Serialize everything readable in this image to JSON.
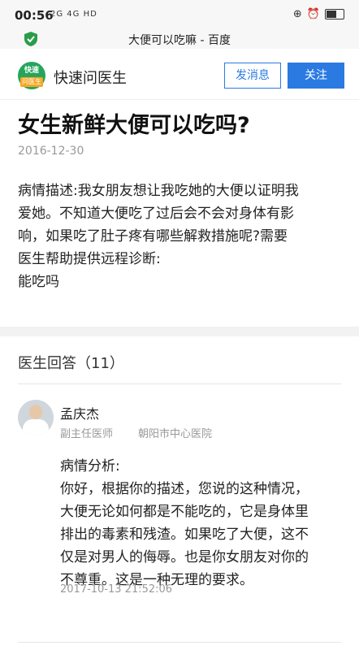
{
  "status_bar": {
    "time": "00:56",
    "network": "2G 4G HD",
    "icons": [
      "alarm-icon",
      "clock-icon",
      "battery-icon"
    ]
  },
  "browser": {
    "page_title": "大便可以吃嘛 - 百度",
    "secure_icon": "shield-check-icon",
    "accent": "#2a9d4a"
  },
  "app_bar": {
    "logo_top": "快速",
    "logo_bottom": "问医生",
    "name": "快速问医生",
    "message_button": "发消息",
    "follow_button": "关注",
    "accent": "#2a7ae2"
  },
  "question": {
    "title": "女生新鲜大便可以吃吗?",
    "date": "2016-12-30",
    "description_lines": [
      "病情描述:我女朋友想让我吃她的大便以证明我",
      "爱她。不知道大便吃了过后会不会对身体有影",
      "响，如果吃了肚子疼有哪些解救措施呢?需要",
      "医生帮助提供远程诊断:",
      "能吃吗"
    ]
  },
  "answers": {
    "header": "医生回答（11）",
    "items": [
      {
        "doctor_name": "孟庆杰",
        "doctor_title": "副主任医师",
        "hospital": "朝阳市中心医院",
        "analysis_lines": [
          "病情分析:",
          "你好，根据你的描述，您说的这种情况，",
          "大便无论如何都是不能吃的，它是身体里",
          "排出的毒素和残渣。如果吃了大便，这不",
          "仅是对男人的侮辱。也是你女朋友对你的",
          "不尊重。这是一种无理的要求。"
        ],
        "datetime": "2017-10-13 21:52:06"
      }
    ]
  }
}
